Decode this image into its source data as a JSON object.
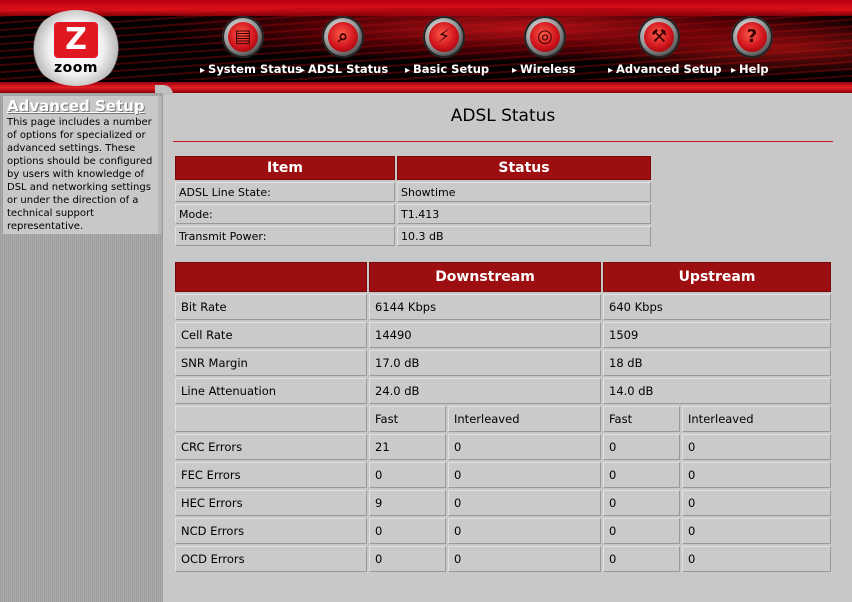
{
  "header": {
    "logo_text": "zoom",
    "nav": [
      {
        "label": "System Status",
        "icon": "folder-icon"
      },
      {
        "label": "ADSL Status",
        "icon": "magnifier-icon"
      },
      {
        "label": "Basic Setup",
        "icon": "plug-icon"
      },
      {
        "label": "Wireless",
        "icon": "wireless-icon"
      },
      {
        "label": "Advanced Setup",
        "icon": "wrench-icon"
      },
      {
        "label": "Help",
        "icon": "question-icon"
      }
    ]
  },
  "sidebar": {
    "title": "Advanced Setup",
    "description": "This page includes a number of options for specialized or advanced settings. These options should be configured by users with knowledge of DSL and networking settings or under the direction of a technical support representative."
  },
  "main": {
    "title": "ADSL Status",
    "status_table": {
      "headers": [
        "Item",
        "Status"
      ],
      "rows": [
        [
          "ADSL Line State:",
          "Showtime"
        ],
        [
          "Mode:",
          "T1.413"
        ],
        [
          "Transmit Power:",
          "10.3 dB"
        ]
      ]
    },
    "stats_table": {
      "headers": [
        "",
        "Downstream",
        "Upstream"
      ],
      "rows": [
        [
          "Bit Rate",
          "6144   Kbps",
          "640   Kbps"
        ],
        [
          "Cell Rate",
          "14490",
          "1509"
        ],
        [
          "SNR Margin",
          "17.0 dB",
          "18 dB"
        ],
        [
          "Line Attenuation",
          "24.0 dB",
          "14.0 dB"
        ]
      ],
      "sub_headers": [
        "",
        "Fast",
        "Interleaved",
        "Fast",
        "Interleaved"
      ],
      "error_rows": [
        [
          "CRC Errors",
          "21",
          "0",
          "0",
          "0"
        ],
        [
          "FEC Errors",
          "0",
          "0",
          "0",
          "0"
        ],
        [
          "HEC Errors",
          "9",
          "0",
          "0",
          "0"
        ],
        [
          "NCD Errors",
          "0",
          "0",
          "0",
          "0"
        ],
        [
          "OCD Errors",
          "0",
          "0",
          "0",
          "0"
        ]
      ]
    }
  },
  "colors": {
    "accent_red": "#9c0e10",
    "background": "#c8c8c8"
  }
}
